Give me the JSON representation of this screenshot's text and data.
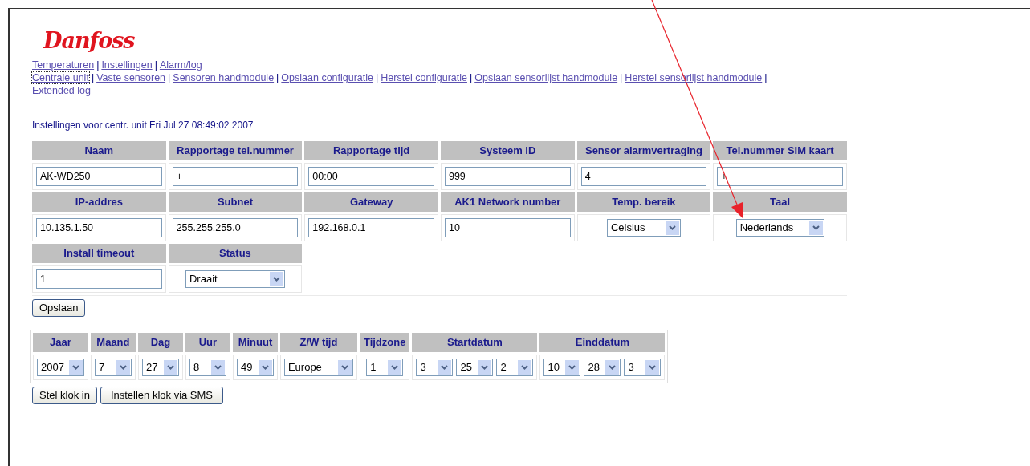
{
  "logo": {
    "text": "Danfoss"
  },
  "nav_rows": [
    [
      {
        "label": "Temperaturen",
        "focused": false,
        "separator": "|"
      },
      {
        "label": "Instellingen",
        "focused": false,
        "separator": "|"
      },
      {
        "label": "Alarm/log",
        "focused": false
      }
    ],
    [
      {
        "label": "Centrale unit",
        "focused": true,
        "separator": "|"
      },
      {
        "label": "Vaste sensoren",
        "focused": false,
        "separator": "|"
      },
      {
        "label": "Sensoren handmodule",
        "focused": false,
        "separator": "|"
      },
      {
        "label": "Opslaan configuratie",
        "focused": false,
        "separator": "|"
      },
      {
        "label": "Herstel configuratie",
        "focused": false,
        "separator": "|"
      },
      {
        "label": "Opslaan sensorlijst handmodule",
        "focused": false,
        "separator": "|"
      },
      {
        "label": "Herstel sensorlijst handmodule",
        "focused": false,
        "separator": "|"
      }
    ],
    [
      {
        "label": "Extended log",
        "focused": false
      }
    ]
  ],
  "heading": "Instellingen voor centr. unit Fri Jul 27 08:49:02 2007",
  "settings_rows": [
    [
      {
        "label": "Naam",
        "kind": "text",
        "value": "AK-WD250"
      },
      {
        "label": "Rapportage tel.nummer",
        "kind": "text",
        "value": "+"
      },
      {
        "label": "Rapportage tijd",
        "kind": "text",
        "value": "00:00"
      },
      {
        "label": "Systeem ID",
        "kind": "text",
        "value": "999"
      },
      {
        "label": "Sensor alarmvertraging",
        "kind": "text",
        "value": "4"
      },
      {
        "label": "Tel.nummer SIM kaart",
        "kind": "text",
        "value": "+"
      }
    ],
    [
      {
        "label": "IP-addres",
        "kind": "text",
        "value": "10.135.1.50"
      },
      {
        "label": "Subnet",
        "kind": "text",
        "value": "255.255.255.0"
      },
      {
        "label": "Gateway",
        "kind": "text",
        "value": "192.168.0.1"
      },
      {
        "label": "AK1 Network number",
        "kind": "text",
        "value": "10"
      },
      {
        "label": "Temp. bereik",
        "kind": "select",
        "value": "Celsius"
      },
      {
        "label": "Taal",
        "kind": "select",
        "value": "Nederlands"
      }
    ],
    [
      {
        "label": "Install timeout",
        "kind": "text",
        "value": "1"
      },
      {
        "label": "Status",
        "kind": "select",
        "value": "Draait"
      }
    ]
  ],
  "save_button": "Opslaan",
  "clock_columns": [
    {
      "label": "Jaar",
      "selects": [
        "2007"
      ]
    },
    {
      "label": "Maand",
      "selects": [
        "7"
      ]
    },
    {
      "label": "Dag",
      "selects": [
        "27"
      ]
    },
    {
      "label": "Uur",
      "selects": [
        "8"
      ]
    },
    {
      "label": "Minuut",
      "selects": [
        "49"
      ]
    },
    {
      "label": "Z/W tijd",
      "selects": [
        "Europe"
      ]
    },
    {
      "label": "Tijdzone",
      "selects": [
        "1"
      ]
    },
    {
      "label": "Startdatum",
      "selects": [
        "3",
        "25",
        "2"
      ]
    },
    {
      "label": "Einddatum",
      "selects": [
        "10",
        "28",
        "3"
      ]
    }
  ],
  "clock_buttons": [
    "Stel klok in",
    "Instellen klok via SMS"
  ]
}
